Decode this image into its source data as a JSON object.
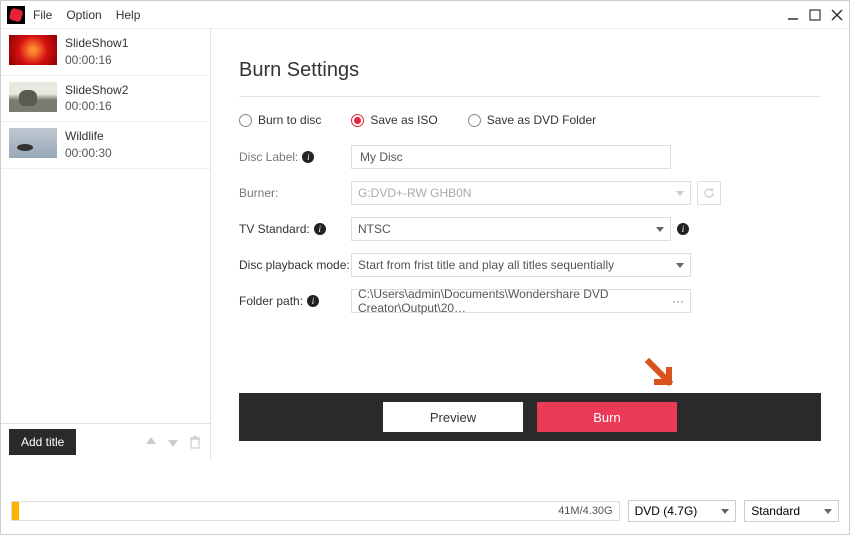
{
  "menu": {
    "file": "File",
    "option": "Option",
    "help": "Help"
  },
  "sidebar": {
    "items": [
      {
        "title": "SlideShow1",
        "time": "00:00:16"
      },
      {
        "title": "SlideShow2",
        "time": "00:00:16"
      },
      {
        "title": "Wildlife",
        "time": "00:00:30"
      }
    ],
    "add_title": "Add title"
  },
  "panel": {
    "title": "Burn Settings",
    "radios": {
      "burn_disc": "Burn to disc",
      "save_iso": "Save as ISO",
      "save_folder": "Save as DVD Folder",
      "selected": "save_iso"
    },
    "labels": {
      "disc_label": "Disc Label:",
      "burner": "Burner:",
      "tv_standard": "TV Standard:",
      "playback": "Disc playback mode:",
      "folder": "Folder path:"
    },
    "values": {
      "disc_label": "My Disc",
      "burner": "G:DVD+-RW GHB0N",
      "tv_standard": "NTSC",
      "playback": "Start from frist title and play all titles sequentially",
      "folder": "C:\\Users\\admin\\Documents\\Wondershare DVD Creator\\Output\\20…"
    },
    "ellipsis": "···"
  },
  "actions": {
    "preview": "Preview",
    "burn": "Burn"
  },
  "bottom": {
    "progress_text": "41M/4.30G",
    "disc_type": "DVD (4.7G)",
    "quality": "Standard"
  }
}
